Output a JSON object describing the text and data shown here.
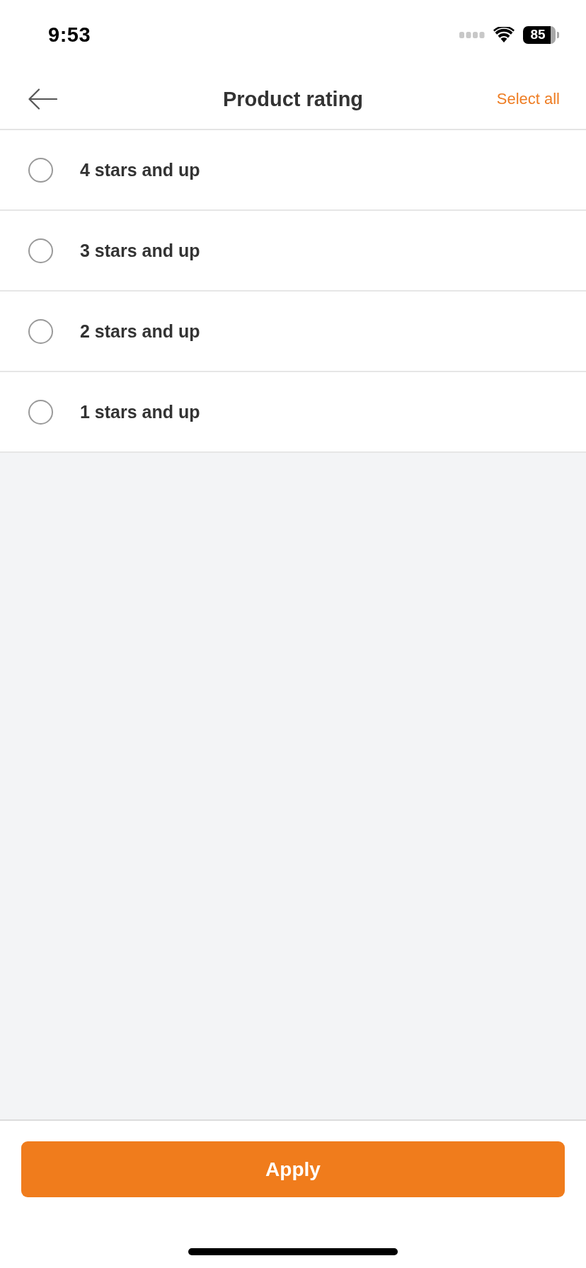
{
  "status_bar": {
    "time": "9:53",
    "battery": "85"
  },
  "nav": {
    "title": "Product rating",
    "action": "Select all"
  },
  "options": [
    {
      "label": "4 stars and up",
      "selected": false
    },
    {
      "label": "3 stars and up",
      "selected": false
    },
    {
      "label": "2 stars and up",
      "selected": false
    },
    {
      "label": "1 stars and up",
      "selected": false
    }
  ],
  "apply_button": {
    "label": "Apply"
  }
}
